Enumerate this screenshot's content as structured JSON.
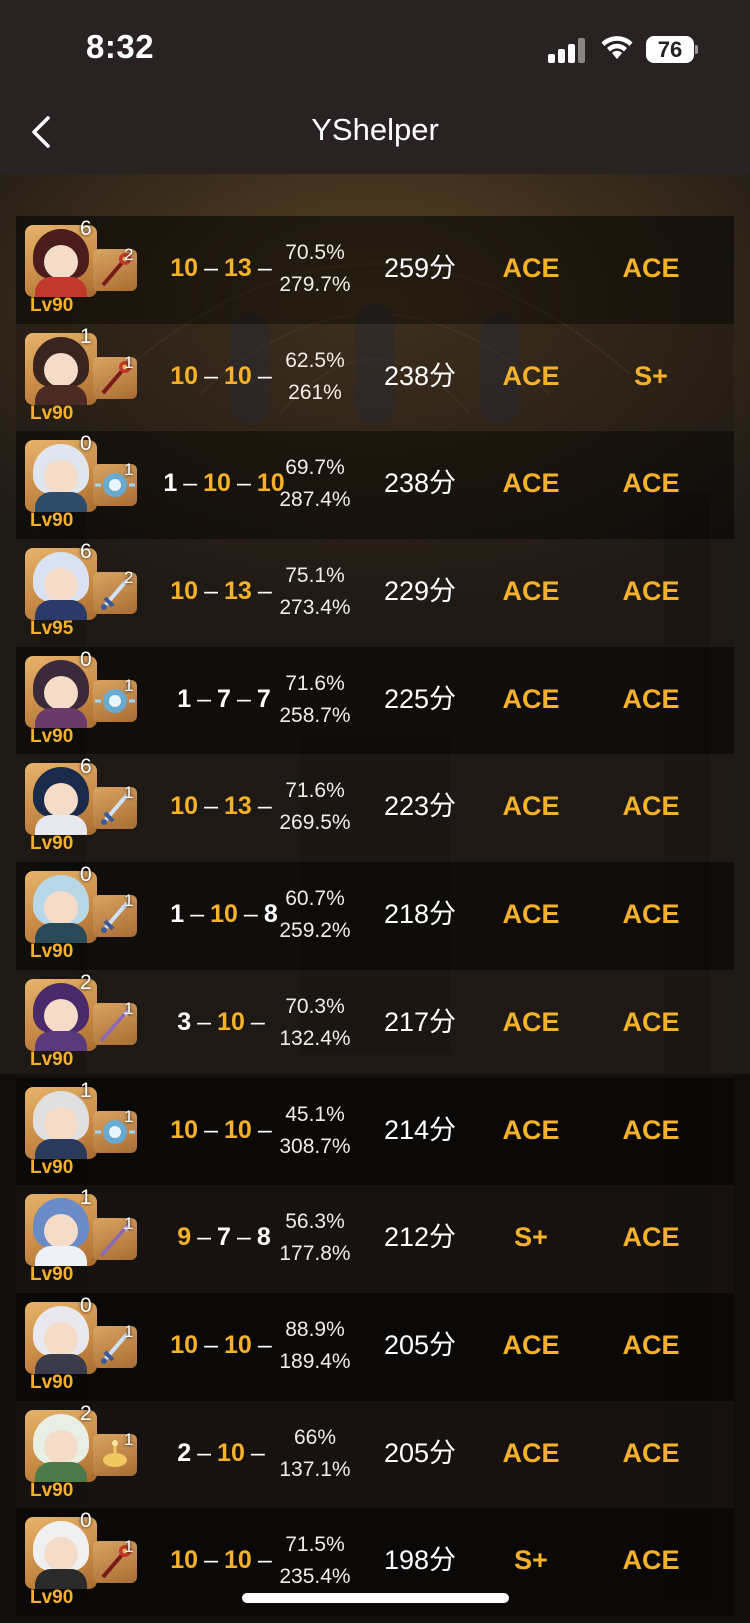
{
  "status_bar": {
    "time": "8:32",
    "battery": "76"
  },
  "nav": {
    "title": "YShelper",
    "back_icon": "chevron-left-icon"
  },
  "colors": {
    "accent": "#f5b12a",
    "header_bg": "#2a2222"
  },
  "rows": [
    {
      "portrait": {
        "hair": "#4a1c1c",
        "outfit": "#c0392b"
      },
      "cons": "6",
      "refine": "2",
      "weapon": "red-staff",
      "level": "Lv90",
      "talents": [
        {
          "v": "10",
          "gold": true
        },
        {
          "v": "13",
          "gold": true
        },
        {
          "v": "",
          "gold": false
        }
      ],
      "crit_rate": "70.5%",
      "crit_dmg": "279.7%",
      "score": "259分",
      "grade_a": "ACE",
      "grade_b": "ACE"
    },
    {
      "portrait": {
        "hair": "#3a2420",
        "outfit": "#4a2a22"
      },
      "cons": "1",
      "refine": "1",
      "weapon": "red-staff",
      "level": "Lv90",
      "talents": [
        {
          "v": "10",
          "gold": true
        },
        {
          "v": "10",
          "gold": true
        },
        {
          "v": "",
          "gold": false
        }
      ],
      "crit_rate": "62.5%",
      "crit_dmg": "261%",
      "score": "238分",
      "grade_a": "ACE",
      "grade_b": "S+"
    },
    {
      "portrait": {
        "hair": "#dfe6ee",
        "outfit": "#2d4c6a"
      },
      "cons": "0",
      "refine": "1",
      "weapon": "blue-catalyst",
      "level": "Lv90",
      "talents": [
        {
          "v": "1",
          "gold": false
        },
        {
          "v": "10",
          "gold": true
        },
        {
          "v": "10",
          "gold": true
        }
      ],
      "crit_rate": "69.7%",
      "crit_dmg": "287.4%",
      "score": "238分",
      "grade_a": "ACE",
      "grade_b": "ACE"
    },
    {
      "portrait": {
        "hair": "#d8e2f2",
        "outfit": "#2a3a6a"
      },
      "cons": "6",
      "refine": "2",
      "weapon": "blue-sword",
      "level": "Lv95",
      "talents": [
        {
          "v": "10",
          "gold": true
        },
        {
          "v": "13",
          "gold": true
        },
        {
          "v": "",
          "gold": false
        }
      ],
      "crit_rate": "75.1%",
      "crit_dmg": "273.4%",
      "score": "229分",
      "grade_a": "ACE",
      "grade_b": "ACE"
    },
    {
      "portrait": {
        "hair": "#3a2a3a",
        "outfit": "#6a3a6a"
      },
      "cons": "0",
      "refine": "1",
      "weapon": "blue-catalyst",
      "level": "Lv90",
      "talents": [
        {
          "v": "1",
          "gold": false
        },
        {
          "v": "7",
          "gold": false
        },
        {
          "v": "7",
          "gold": false
        }
      ],
      "crit_rate": "71.6%",
      "crit_dmg": "258.7%",
      "score": "225分",
      "grade_a": "ACE",
      "grade_b": "ACE"
    },
    {
      "portrait": {
        "hair": "#1a2a4a",
        "outfit": "#e8e8f0"
      },
      "cons": "6",
      "refine": "1",
      "weapon": "blue-sword",
      "level": "Lv90",
      "talents": [
        {
          "v": "10",
          "gold": true
        },
        {
          "v": "13",
          "gold": true
        },
        {
          "v": "",
          "gold": false
        }
      ],
      "crit_rate": "71.6%",
      "crit_dmg": "269.5%",
      "score": "223分",
      "grade_a": "ACE",
      "grade_b": "ACE"
    },
    {
      "portrait": {
        "hair": "#b8d8e8",
        "outfit": "#2a4a5a"
      },
      "cons": "0",
      "refine": "1",
      "weapon": "blue-sword",
      "level": "Lv90",
      "talents": [
        {
          "v": "1",
          "gold": false
        },
        {
          "v": "10",
          "gold": true
        },
        {
          "v": "8",
          "gold": false
        }
      ],
      "crit_rate": "60.7%",
      "crit_dmg": "259.2%",
      "score": "218分",
      "grade_a": "ACE",
      "grade_b": "ACE"
    },
    {
      "portrait": {
        "hair": "#4a2a6a",
        "outfit": "#5a3a7a"
      },
      "cons": "2",
      "refine": "1",
      "weapon": "purple-polearm",
      "level": "Lv90",
      "talents": [
        {
          "v": "3",
          "gold": false
        },
        {
          "v": "10",
          "gold": true
        },
        {
          "v": "",
          "gold": false
        }
      ],
      "crit_rate": "70.3%",
      "crit_dmg": "132.4%",
      "score": "217分",
      "grade_a": "ACE",
      "grade_b": "ACE"
    },
    {
      "portrait": {
        "hair": "#e0e0e0",
        "outfit": "#2a3a5a"
      },
      "cons": "1",
      "refine": "1",
      "weapon": "blue-catalyst",
      "level": "Lv90",
      "talents": [
        {
          "v": "10",
          "gold": true
        },
        {
          "v": "10",
          "gold": true
        },
        {
          "v": "",
          "gold": false
        }
      ],
      "crit_rate": "45.1%",
      "crit_dmg": "308.7%",
      "score": "214分",
      "grade_a": "ACE",
      "grade_b": "ACE"
    },
    {
      "portrait": {
        "hair": "#6a8ac8",
        "outfit": "#eef2f8"
      },
      "cons": "1",
      "refine": "1",
      "weapon": "purple-polearm",
      "level": "Lv90",
      "talents": [
        {
          "v": "9",
          "gold": true
        },
        {
          "v": "7",
          "gold": false
        },
        {
          "v": "8",
          "gold": false
        }
      ],
      "crit_rate": "56.3%",
      "crit_dmg": "177.8%",
      "score": "212分",
      "grade_a": "S+",
      "grade_b": "ACE"
    },
    {
      "portrait": {
        "hair": "#e8e8ee",
        "outfit": "#3a3a4a"
      },
      "cons": "0",
      "refine": "1",
      "weapon": "blue-sword",
      "level": "Lv90",
      "talents": [
        {
          "v": "10",
          "gold": true
        },
        {
          "v": "10",
          "gold": true
        },
        {
          "v": "",
          "gold": false
        }
      ],
      "crit_rate": "88.9%",
      "crit_dmg": "189.4%",
      "score": "205分",
      "grade_a": "ACE",
      "grade_b": "ACE"
    },
    {
      "portrait": {
        "hair": "#e8efe4",
        "outfit": "#4a7a4a"
      },
      "cons": "2",
      "refine": "1",
      "weapon": "gold-lamp",
      "level": "Lv90",
      "talents": [
        {
          "v": "2",
          "gold": false
        },
        {
          "v": "10",
          "gold": true
        },
        {
          "v": "",
          "gold": false
        }
      ],
      "crit_rate": "66%",
      "crit_dmg": "137.1%",
      "score": "205分",
      "grade_a": "ACE",
      "grade_b": "ACE"
    },
    {
      "portrait": {
        "hair": "#f0f0f0",
        "outfit": "#2a2a2a"
      },
      "cons": "0",
      "refine": "1",
      "weapon": "red-staff",
      "level": "Lv90",
      "talents": [
        {
          "v": "10",
          "gold": true
        },
        {
          "v": "10",
          "gold": true
        },
        {
          "v": "",
          "gold": false
        }
      ],
      "crit_rate": "71.5%",
      "crit_dmg": "235.4%",
      "score": "198分",
      "grade_a": "S+",
      "grade_b": "ACE"
    }
  ]
}
